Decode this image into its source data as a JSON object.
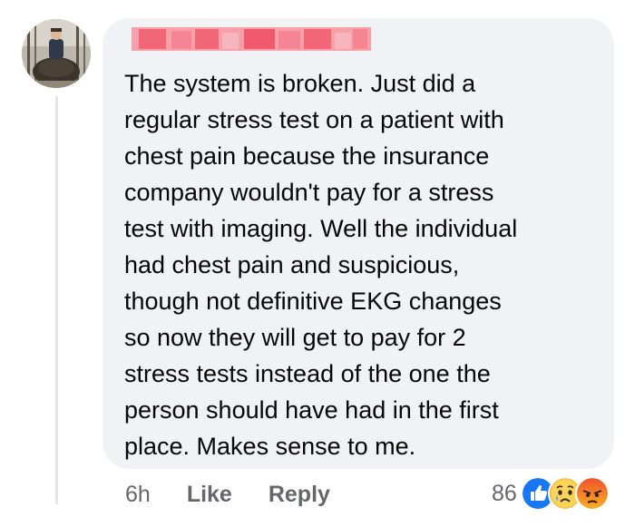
{
  "comment": {
    "author_name_redacted": true,
    "text": "The system is broken. Just did a\nregular stress test on a patient with\nchest pain because the insurance\ncompany wouldn't pay for a stress\ntest with imaging. Well the individual\nhad chest pain and suspicious,\nthough not definitive EKG changes\nso now they will get to pay for 2\nstress tests instead of the one the\nperson should have had in the first\nplace. Makes sense to me.",
    "timestamp": "6h",
    "like_label": "Like",
    "reply_label": "Reply",
    "reaction_count": "86",
    "reaction_icons": [
      "like-icon",
      "sad-icon",
      "angry-icon"
    ]
  },
  "colors": {
    "bubble_background": "#f0f2f5",
    "text": "#050505",
    "secondary_text": "#65676b",
    "like_blue": "#1877f2",
    "redaction_red": "#f0556a"
  }
}
